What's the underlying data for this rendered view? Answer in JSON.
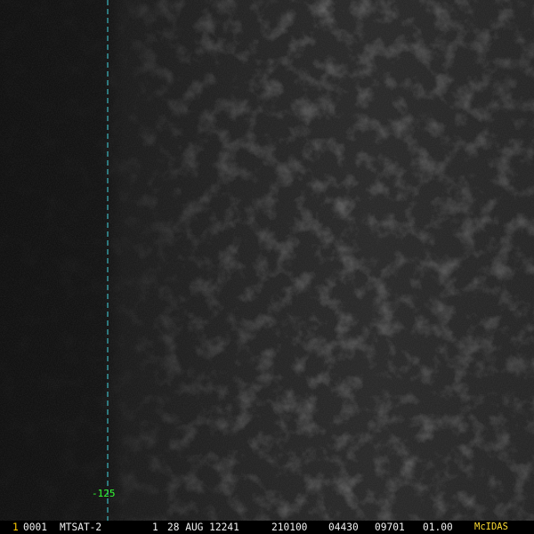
{
  "image": {
    "description_icon": "satellite-visible-imagery",
    "colors": {
      "background": "#000000",
      "meridian_line": "#44d6e0",
      "longitude_label": "#33ff33",
      "frame_number": "#ffcc00",
      "status_text": "#f2f2f2",
      "mcidas_label": "#ffdd33"
    }
  },
  "overlay": {
    "meridian_label": "-125"
  },
  "status_bar": {
    "frame_number": "1",
    "frame_id": "0001",
    "satellite": "MTSAT-2",
    "band": "1",
    "date": "28 AUG 12241",
    "time": "210100",
    "line": "04430",
    "element": "09701",
    "resolution": "01.00",
    "software": "McIDAS"
  }
}
